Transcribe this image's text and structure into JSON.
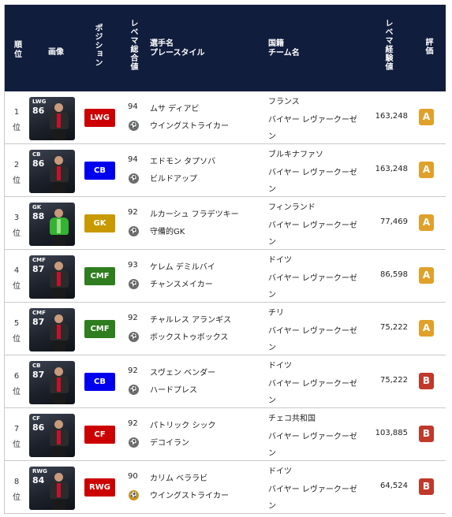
{
  "header": {
    "rank": "順\n位",
    "image": "画像",
    "position": "ポジション",
    "level_overall": "レベマ総合値",
    "name_style": "選手名\nプレースタイル",
    "nation_team": "国籍\nチーム名",
    "level_exp": "レベマ経験値",
    "grade": "評価"
  },
  "colors": {
    "header_bg": "#111d3d",
    "forward_red": "#cc0000",
    "midfield_green": "#2e7d1e",
    "defender_blue": "#0000ee",
    "goalkeeper_gold": "#c89a00",
    "grade_A": "#e0a12a",
    "grade_B": "#c0392b"
  },
  "rows": [
    {
      "rank": "1\n位",
      "card_pos": "LWG",
      "card_ovr": "86",
      "pos": "LWG",
      "pos_color": "#cc0000",
      "lv": "94",
      "coin": "gray-ball-icon",
      "name": "ムサ ディアビ",
      "style": "ウイングストライカー",
      "nation": "フランス",
      "team": "バイヤー レヴァークーゼン",
      "exp": "163,248",
      "grade": "A",
      "grade_color": "#e0a12a"
    },
    {
      "rank": "2\n位",
      "card_pos": "CB",
      "card_ovr": "86",
      "pos": "CB",
      "pos_color": "#0000ee",
      "lv": "94",
      "coin": "gray-ball-icon",
      "name": "エドモン タプソバ",
      "style": "ビルドアップ",
      "nation": "ブルキナファソ",
      "team": "バイヤー レヴァークーゼン",
      "exp": "163,248",
      "grade": "A",
      "grade_color": "#e0a12a"
    },
    {
      "rank": "3\n位",
      "card_pos": "GK",
      "card_ovr": "88",
      "pos": "GK",
      "pos_color": "#c89a00",
      "lv": "92",
      "coin": "gray-ball-icon",
      "name": "ルカーシュ フラデツキー",
      "style": "守備的GK",
      "nation": "フィンランド",
      "team": "バイヤー レヴァークーゼン",
      "exp": "77,469",
      "grade": "A",
      "grade_color": "#e0a12a"
    },
    {
      "rank": "4\n位",
      "card_pos": "CMF",
      "card_ovr": "87",
      "pos": "CMF",
      "pos_color": "#2e7d1e",
      "lv": "93",
      "coin": "gray-ball-icon",
      "name": "ケレム デミルバイ",
      "style": "チャンスメイカー",
      "nation": "ドイツ",
      "team": "バイヤー レヴァークーゼン",
      "exp": "86,598",
      "grade": "A",
      "grade_color": "#e0a12a"
    },
    {
      "rank": "5\n位",
      "card_pos": "CMF",
      "card_ovr": "87",
      "pos": "CMF",
      "pos_color": "#2e7d1e",
      "lv": "92",
      "coin": "gray-ball-icon",
      "name": "チャルレス アランギス",
      "style": "ボックストゥボックス",
      "nation": "チリ",
      "team": "バイヤー レヴァークーゼン",
      "exp": "75,222",
      "grade": "A",
      "grade_color": "#e0a12a"
    },
    {
      "rank": "6\n位",
      "card_pos": "CB",
      "card_ovr": "87",
      "pos": "CB",
      "pos_color": "#0000ee",
      "lv": "92",
      "coin": "gray-ball-icon",
      "name": "スヴェン ベンダー",
      "style": "ハードプレス",
      "nation": "ドイツ",
      "team": "バイヤー レヴァークーゼン",
      "exp": "75,222",
      "grade": "B",
      "grade_color": "#c0392b"
    },
    {
      "rank": "7\n位",
      "card_pos": "CF",
      "card_ovr": "86",
      "pos": "CF",
      "pos_color": "#cc0000",
      "lv": "92",
      "coin": "gray-ball-icon",
      "name": "パトリック シック",
      "style": "デコイラン",
      "nation": "チェコ共和国",
      "team": "バイヤー レヴァークーゼン",
      "exp": "103,885",
      "grade": "B",
      "grade_color": "#c0392b"
    },
    {
      "rank": "8\n位",
      "card_pos": "RWG",
      "card_ovr": "84",
      "pos": "RWG",
      "pos_color": "#cc0000",
      "lv": "90",
      "coin": "gold-ball-icon",
      "name": "カリム ベララビ",
      "style": "ウイングストライカー",
      "nation": "ドイツ",
      "team": "バイヤー レヴァークーゼン",
      "exp": "64,524",
      "grade": "B",
      "grade_color": "#c0392b"
    }
  ]
}
